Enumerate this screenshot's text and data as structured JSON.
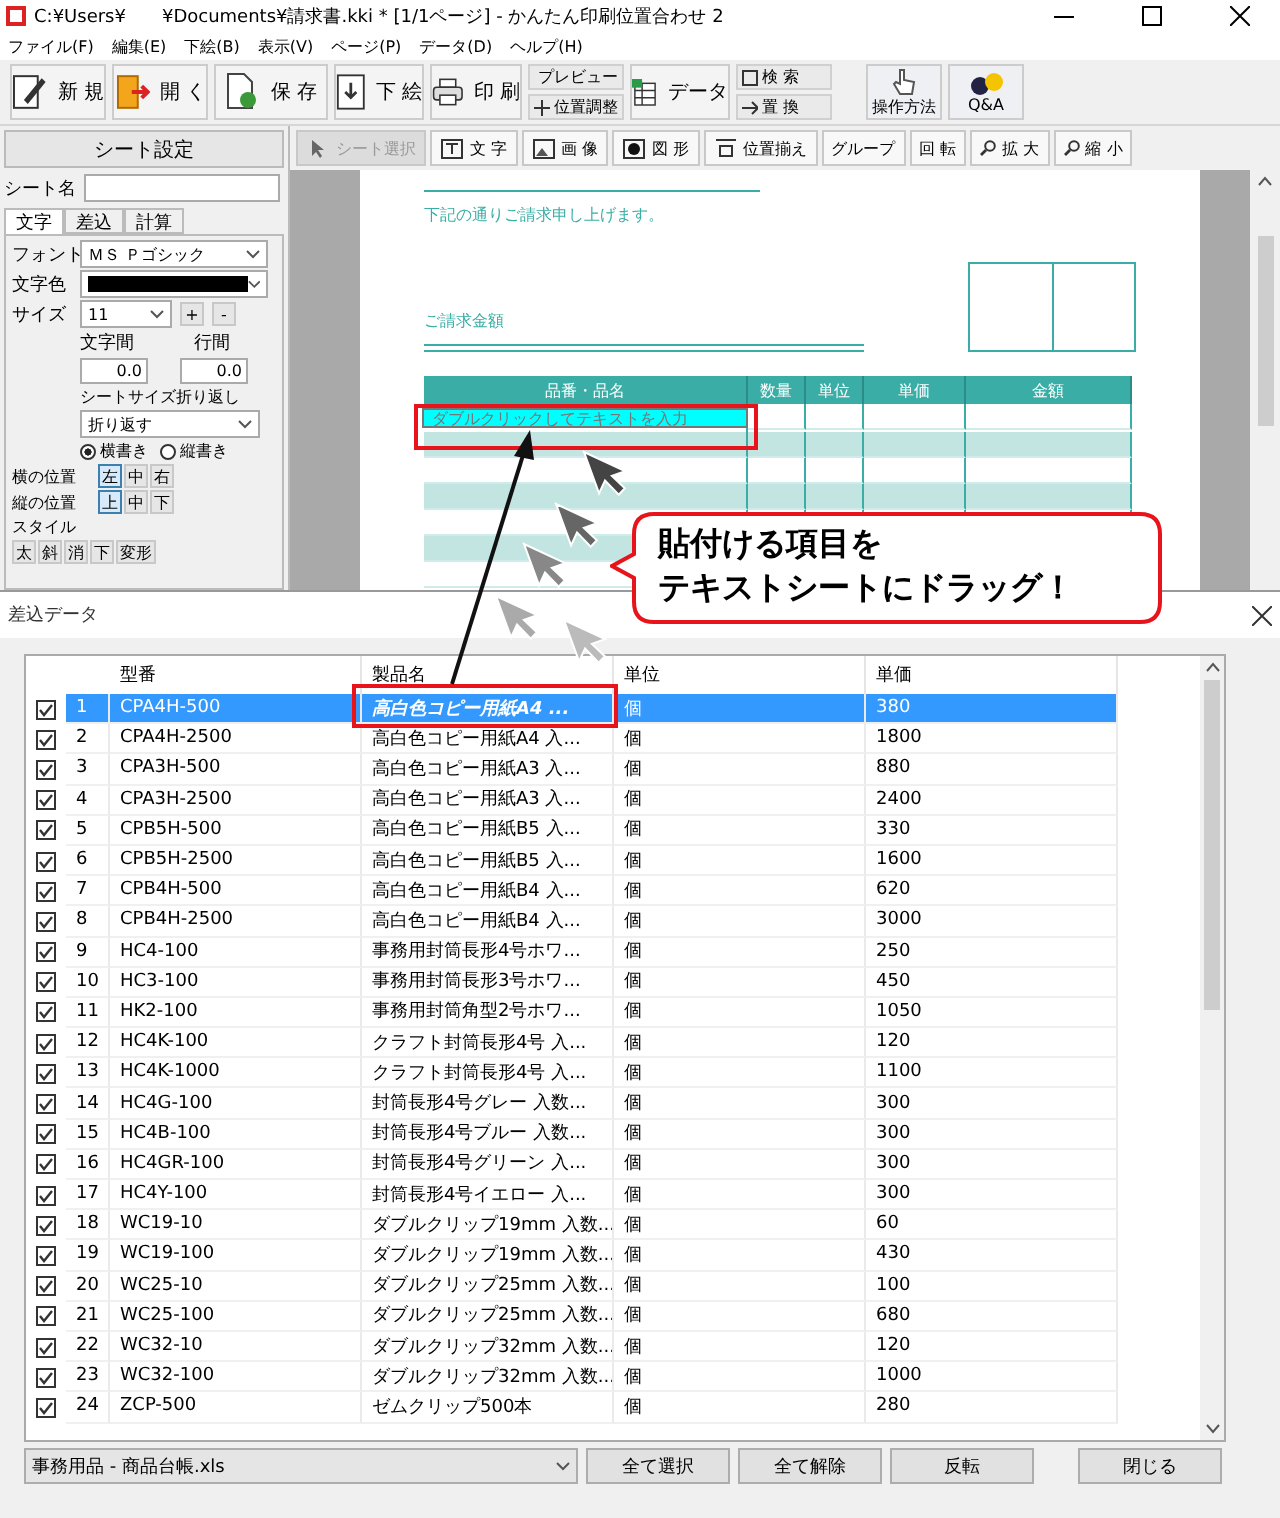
{
  "window": {
    "title": "C:¥Users¥　　¥Documents¥請求書.kki * [1/1ページ] - かんたん印刷位置合わせ 2"
  },
  "menu": [
    "ファイル(F)",
    "編集(E)",
    "下絵(B)",
    "表示(V)",
    "ページ(P)",
    "データ(D)",
    "ヘルプ(H)"
  ],
  "toolbar": [
    {
      "kind": "button",
      "label": "新 規"
    },
    {
      "kind": "button",
      "label": "開 く"
    },
    {
      "kind": "button",
      "label": "保 存"
    },
    {
      "kind": "button",
      "label": "下 絵"
    },
    {
      "kind": "button",
      "label": "印 刷"
    },
    {
      "kind": "stack",
      "items": [
        "プレビュー",
        "位置調整"
      ]
    },
    {
      "kind": "button",
      "label": "データ"
    },
    {
      "kind": "stack",
      "items": [
        "検 索",
        "置 換"
      ]
    },
    {
      "kind": "tall",
      "label": "操作方法"
    },
    {
      "kind": "tall",
      "label": "Q&A"
    }
  ],
  "sheet_settings": {
    "title": "シート設定",
    "name_label": "シート名",
    "tabs": [
      {
        "label": "文字",
        "selected": true
      },
      {
        "label": "差込",
        "selected": false
      },
      {
        "label": "計算",
        "selected": false
      }
    ],
    "font_label": "フォント",
    "font_value": "ＭＳ Ｐゴシック",
    "color_label": "文字色",
    "size_label": "サイズ",
    "size_value": "11",
    "size_buttons": [
      "+",
      "-"
    ],
    "char_spacing_label": "文字間",
    "char_spacing": "0.0",
    "line_spacing_label": "行間",
    "line_spacing": "0.0",
    "wrap_label": "シートサイズ折り返し",
    "wrap_value": "折り返す",
    "orientation": [
      {
        "label": "横書き",
        "selected": true
      },
      {
        "label": "縦書き",
        "selected": false
      }
    ],
    "h_align": {
      "label": "横の位置",
      "options": [
        {
          "label": "左",
          "selected": true
        },
        {
          "label": "中",
          "selected": false
        },
        {
          "label": "右",
          "selected": false
        }
      ]
    },
    "v_align": {
      "label": "縦の位置",
      "options": [
        {
          "label": "上",
          "selected": true
        },
        {
          "label": "中",
          "selected": false
        },
        {
          "label": "下",
          "selected": false
        }
      ]
    },
    "style": {
      "label": "スタイル",
      "buttons": [
        "太",
        "斜",
        "消",
        "下",
        "変形"
      ]
    }
  },
  "tools": [
    {
      "label": "シート選択",
      "selected": true
    },
    {
      "label": "文 字",
      "selected": false
    },
    {
      "label": "画 像",
      "selected": false
    },
    {
      "label": "図 形",
      "selected": false
    },
    {
      "label": "位置揃え",
      "selected": false
    },
    {
      "label": "グループ",
      "selected": false
    },
    {
      "label": "回 転",
      "selected": false
    },
    {
      "label": "拡 大",
      "selected": false
    },
    {
      "label": "縮 小",
      "selected": false
    }
  ],
  "document": {
    "intro": "下記の通りご請求申し上げます。",
    "amount_title": "ご請求金額",
    "columns": [
      "品番・品名",
      "数量",
      "単位",
      "単価",
      "金額"
    ],
    "text_sheet": "ダブルクリックしてテキストを入力"
  },
  "dialog": {
    "title": "差込データ",
    "columns": [
      "型番",
      "製品名",
      "単位",
      "単価"
    ],
    "rows": [
      {
        "checked": true,
        "no": "1",
        "model": "CPA4H-500",
        "name": "高白色コピー用紙A4 ...",
        "unit": "個",
        "price": "380",
        "selected": true
      },
      {
        "checked": true,
        "no": "2",
        "model": "CPA4H-2500",
        "name": "高白色コピー用紙A4 入...",
        "unit": "個",
        "price": "1800",
        "selected": false
      },
      {
        "checked": true,
        "no": "3",
        "model": "CPA3H-500",
        "name": "高白色コピー用紙A3 入...",
        "unit": "個",
        "price": "880",
        "selected": false
      },
      {
        "checked": true,
        "no": "4",
        "model": "CPA3H-2500",
        "name": "高白色コピー用紙A3 入...",
        "unit": "個",
        "price": "2400",
        "selected": false
      },
      {
        "checked": true,
        "no": "5",
        "model": "CPB5H-500",
        "name": "高白色コピー用紙B5 入...",
        "unit": "個",
        "price": "330",
        "selected": false
      },
      {
        "checked": true,
        "no": "6",
        "model": "CPB5H-2500",
        "name": "高白色コピー用紙B5 入...",
        "unit": "個",
        "price": "1600",
        "selected": false
      },
      {
        "checked": true,
        "no": "7",
        "model": "CPB4H-500",
        "name": "高白色コピー用紙B4 入...",
        "unit": "個",
        "price": "620",
        "selected": false
      },
      {
        "checked": true,
        "no": "8",
        "model": "CPB4H-2500",
        "name": "高白色コピー用紙B4 入...",
        "unit": "個",
        "price": "3000",
        "selected": false
      },
      {
        "checked": true,
        "no": "9",
        "model": "HC4-100",
        "name": "事務用封筒長形4号ホワ...",
        "unit": "個",
        "price": "250",
        "selected": false
      },
      {
        "checked": true,
        "no": "10",
        "model": "HC3-100",
        "name": "事務用封筒長形3号ホワ...",
        "unit": "個",
        "price": "450",
        "selected": false
      },
      {
        "checked": true,
        "no": "11",
        "model": "HK2-100",
        "name": "事務用封筒角型2号ホワ...",
        "unit": "個",
        "price": "1050",
        "selected": false
      },
      {
        "checked": true,
        "no": "12",
        "model": "HC4K-100",
        "name": "クラフト封筒長形4号 入...",
        "unit": "個",
        "price": "120",
        "selected": false
      },
      {
        "checked": true,
        "no": "13",
        "model": "HC4K-1000",
        "name": "クラフト封筒長形4号 入...",
        "unit": "個",
        "price": "1100",
        "selected": false
      },
      {
        "checked": true,
        "no": "14",
        "model": "HC4G-100",
        "name": "封筒長形4号グレー 入数...",
        "unit": "個",
        "price": "300",
        "selected": false
      },
      {
        "checked": true,
        "no": "15",
        "model": "HC4B-100",
        "name": "封筒長形4号ブルー 入数...",
        "unit": "個",
        "price": "300",
        "selected": false
      },
      {
        "checked": true,
        "no": "16",
        "model": "HC4GR-100",
        "name": "封筒長形4号グリーン 入...",
        "unit": "個",
        "price": "300",
        "selected": false
      },
      {
        "checked": true,
        "no": "17",
        "model": "HC4Y-100",
        "name": "封筒長形4号イエロー 入...",
        "unit": "個",
        "price": "300",
        "selected": false
      },
      {
        "checked": true,
        "no": "18",
        "model": "WC19-10",
        "name": "ダブルクリップ19mm 入数...",
        "unit": "個",
        "price": "60",
        "selected": false
      },
      {
        "checked": true,
        "no": "19",
        "model": "WC19-100",
        "name": "ダブルクリップ19mm 入数...",
        "unit": "個",
        "price": "430",
        "selected": false
      },
      {
        "checked": true,
        "no": "20",
        "model": "WC25-10",
        "name": "ダブルクリップ25mm 入数...",
        "unit": "個",
        "price": "100",
        "selected": false
      },
      {
        "checked": true,
        "no": "21",
        "model": "WC25-100",
        "name": "ダブルクリップ25mm 入数...",
        "unit": "個",
        "price": "680",
        "selected": false
      },
      {
        "checked": true,
        "no": "22",
        "model": "WC32-10",
        "name": "ダブルクリップ32mm 入数...",
        "unit": "個",
        "price": "120",
        "selected": false
      },
      {
        "checked": true,
        "no": "23",
        "model": "WC32-100",
        "name": "ダブルクリップ32mm 入数...",
        "unit": "個",
        "price": "1000",
        "selected": false
      },
      {
        "checked": true,
        "no": "24",
        "model": "ZCP-500",
        "name": "ゼムクリップ500本",
        "unit": "個",
        "price": "280",
        "selected": false
      }
    ],
    "file_select": "事務用品 - 商品台帳.xls",
    "buttons": [
      "全て選択",
      "全て解除",
      "反転"
    ],
    "close_button": "閉じる"
  },
  "callout": [
    "貼付ける項目を",
    "テキストシートにドラッグ！"
  ]
}
